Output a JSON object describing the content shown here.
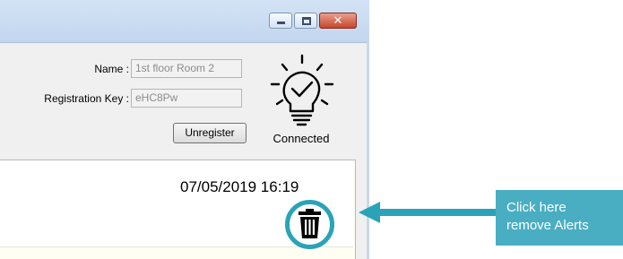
{
  "window": {
    "close_glyph": "✕",
    "fields": {
      "name_label": "Name :",
      "name_value": "1st floor Room 2",
      "key_label": "Registration Key :",
      "key_value": "eHC8Pw"
    },
    "unregister_label": "Unregister",
    "status": {
      "icon": "lightbulb-check-icon",
      "label": "Connected"
    }
  },
  "alerts": {
    "items": [
      {
        "timestamp": "07/05/2019 16:19",
        "delete_icon": "trash-icon"
      }
    ]
  },
  "callout": {
    "line1": "Click here",
    "line2": "remove Alerts",
    "color": "#4aaec3"
  },
  "colors": {
    "accent": "#2aa3b8"
  }
}
